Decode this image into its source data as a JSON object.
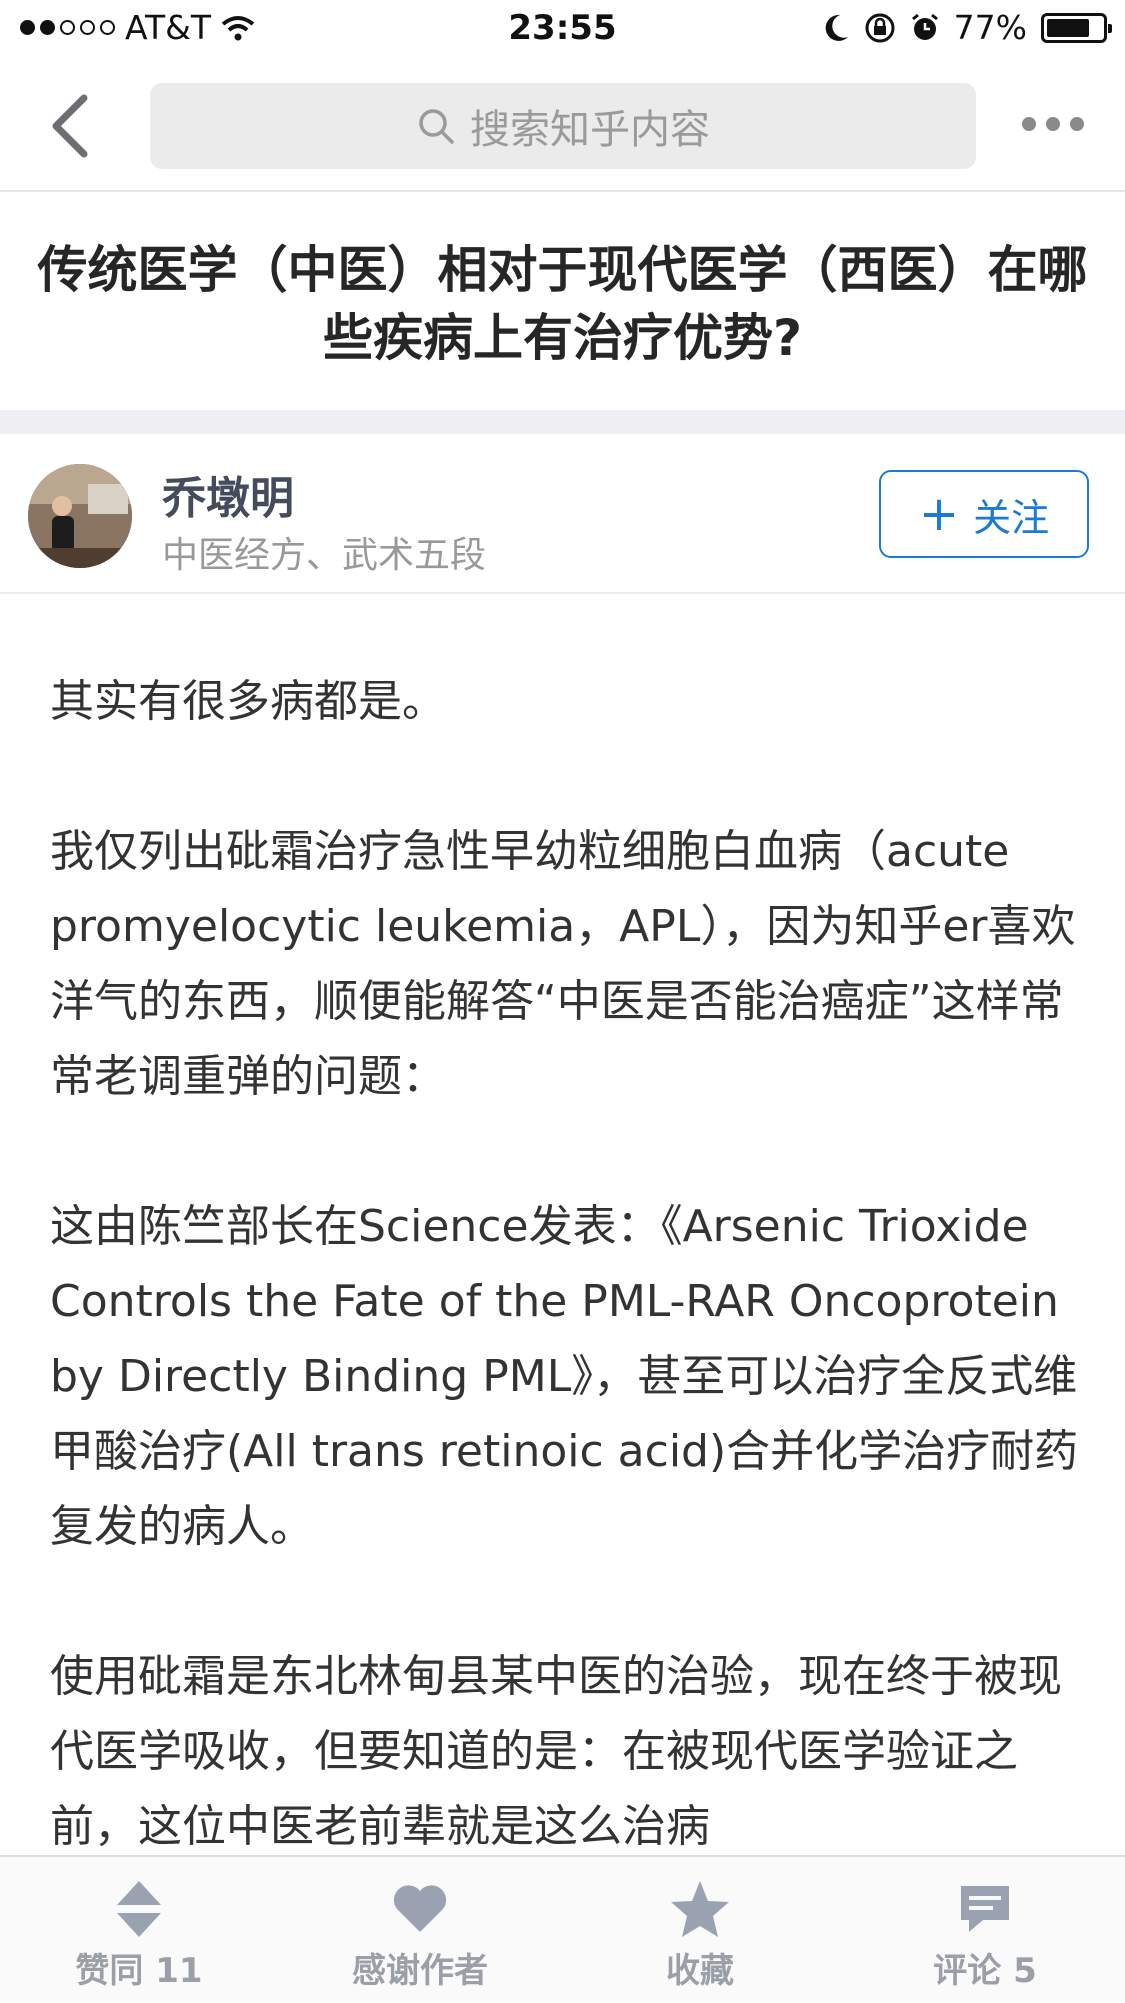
{
  "status_bar": {
    "carrier": "AT&T",
    "time": "23:55",
    "battery": "77%",
    "battery_level": 0.77
  },
  "nav": {
    "search_placeholder": "搜索知乎内容"
  },
  "question": {
    "title": "传统医学（中医）相对于现代医学（西医）在哪些疾病上有治疗优势?"
  },
  "author": {
    "name": "乔墩明",
    "description": "中医经方、武术五段",
    "follow_label": "关注"
  },
  "answer": {
    "paragraphs": [
      "其实有很多病都是。",
      "我仅列出砒霜治疗急性早幼粒细胞白血病（acute promyelocytic leukemia，APL），因为知乎er喜欢洋气的东西，顺便能解答“中医是否能治癌症”这样常常老调重弹的问题：",
      "这由陈竺部长在Science发表：《Arsenic Trioxide Controls the Fate of the PML-RAR Oncoprotein by Directly Binding PML》，甚至可以治疗全反式维甲酸治疗(All trans retinoic acid)合并化学治疗耐药复发的病人。",
      "使用砒霜是东北林甸县某中医的治验，现在终于被现代医学吸收，但要知道的是：在被现代医学验证之前，这位中医老前辈就是这么治病"
    ]
  },
  "tabbar": {
    "vote_label": "赞同 11",
    "thanks_label": "感谢作者",
    "collect_label": "收藏",
    "comment_label": "评论 5"
  }
}
